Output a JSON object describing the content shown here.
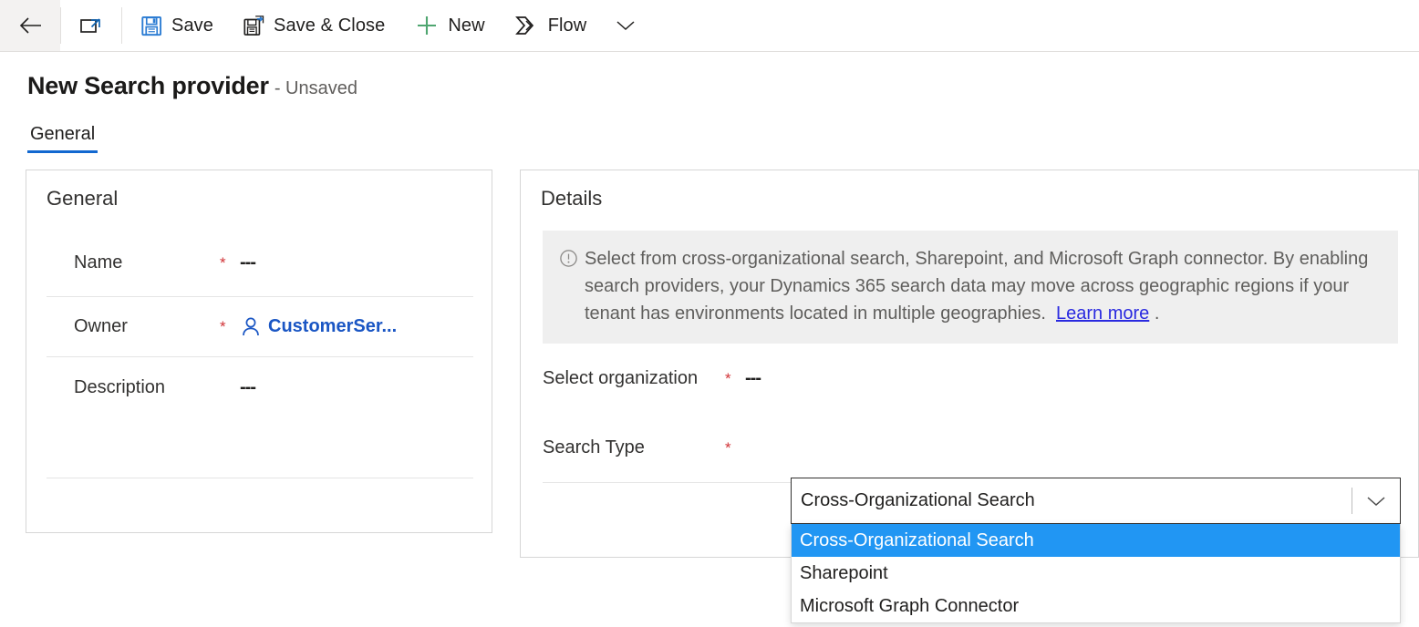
{
  "commandbar": {
    "back": {
      "label": "",
      "icon": "back-arrow-icon"
    },
    "popout": {
      "label": "",
      "icon": "open-in-new-window-icon"
    },
    "save": {
      "label": "Save",
      "icon": "save-icon"
    },
    "save_close": {
      "label": "Save & Close",
      "icon": "save-and-close-icon"
    },
    "new": {
      "label": "New",
      "icon": "plus-icon"
    },
    "flow": {
      "label": "Flow",
      "icon": "flow-icon"
    },
    "overflow": {
      "label": "",
      "icon": "chevron-down-icon"
    }
  },
  "header": {
    "title": "New Search provider",
    "subtitle": "- Unsaved"
  },
  "tabs": [
    {
      "label": "General",
      "active": true
    }
  ],
  "general_panel": {
    "title": "General",
    "fields": [
      {
        "label": "Name",
        "required": "*",
        "value": "---",
        "type": "text"
      },
      {
        "label": "Owner",
        "required": "*",
        "value": "CustomerSer...",
        "type": "lookup",
        "icon": "person-icon"
      },
      {
        "label": "Description",
        "required": "",
        "value": "---",
        "type": "text"
      }
    ]
  },
  "details_panel": {
    "title": "Details",
    "banner": {
      "icon": "info-circle-icon",
      "text": "Select from cross-organizational search, Sharepoint, and Microsoft Graph connector. By enabling search providers, your Dynamics 365 search data may move across geographic regions if your tenant has environments located in multiple geographies.",
      "link": "Learn more",
      "period": "."
    },
    "fields": [
      {
        "label": "Select organization",
        "required": "*",
        "value": "---"
      },
      {
        "label": "Search Type",
        "required": "*",
        "value": "Cross-Organizational Search"
      }
    ]
  },
  "dropdown": {
    "name": "search-type-dropdown",
    "value": "Cross-Organizational Search",
    "expanded": true,
    "arrow_icon": "chevron-down-icon",
    "options": [
      {
        "label": "Cross-Organizational Search",
        "selected": true
      },
      {
        "label": "Sharepoint",
        "selected": false
      },
      {
        "label": "Microsoft Graph Connector",
        "selected": false
      }
    ]
  },
  "colors": {
    "accent_blue": "#1268d0",
    "link_blue": "#1a56c4",
    "required_red": "#d13438",
    "new_green": "#4fa670",
    "highlight_blue": "#2196f3",
    "banner_bg": "#efefef",
    "save_icon_blue": "#2b7cd3"
  }
}
